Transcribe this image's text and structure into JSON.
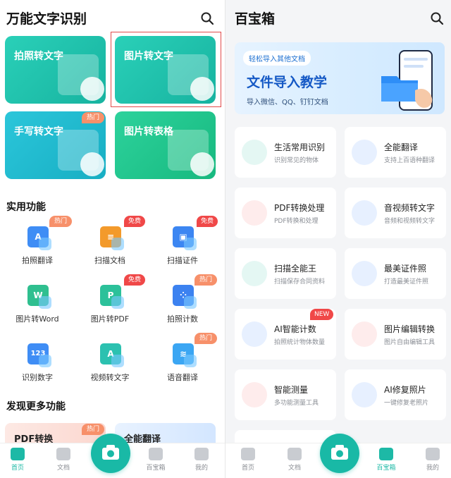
{
  "left": {
    "title": "万能文字识别",
    "cards": [
      {
        "label": "拍照转文字",
        "color": "#1fc2ad"
      },
      {
        "label": "图片转文字",
        "color": "#1fc2ad",
        "selected": true
      },
      {
        "label": "手写转文字",
        "color": "#1fb7c9",
        "badge": "热门"
      },
      {
        "label": "图片转表格",
        "color": "#20c38a"
      }
    ],
    "section_tools": "实用功能",
    "tools": [
      {
        "label": "拍照翻译",
        "icon": "translate-icon",
        "glyph": "A",
        "color": "#3f8df5",
        "badge": "热门"
      },
      {
        "label": "扫描文档",
        "icon": "document-icon",
        "glyph": "≡",
        "color": "#f39a2b",
        "badge_free": "免费"
      },
      {
        "label": "扫描证件",
        "icon": "id-card-icon",
        "glyph": "▣",
        "color": "#3c86f2",
        "badge_free": "免费"
      },
      {
        "label": "图片转Word",
        "icon": "word-icon",
        "glyph": "W",
        "color": "#2fbf8f"
      },
      {
        "label": "图片转PDF",
        "icon": "pdf-icon",
        "glyph": "P",
        "color": "#2cc19a",
        "badge_free": "免费"
      },
      {
        "label": "拍照计数",
        "icon": "count-icon",
        "glyph": "⁘",
        "color": "#3c82f0",
        "badge": "热门"
      },
      {
        "label": "识别数字",
        "icon": "number-icon",
        "glyph": "123",
        "color": "#3f8df5"
      },
      {
        "label": "视频转文字",
        "icon": "video-icon",
        "glyph": "A",
        "color": "#2cc1b0"
      },
      {
        "label": "语音翻译",
        "icon": "voice-icon",
        "glyph": "≋",
        "color": "#3ba6f3",
        "badge": "热门"
      }
    ],
    "section_more": "发现更多功能",
    "promo": [
      {
        "label": "PDF转换",
        "badge": "热门"
      },
      {
        "label": "全能翻译"
      }
    ],
    "tabs": [
      {
        "label": "首页",
        "icon": "home-icon",
        "active": true
      },
      {
        "label": "文档",
        "icon": "document-tab-icon"
      },
      {
        "label": "百宝箱",
        "icon": "toolbox-icon"
      },
      {
        "label": "我的",
        "icon": "profile-icon"
      }
    ]
  },
  "right": {
    "title": "百宝箱",
    "banner": {
      "pill": "轻松导入其他文档",
      "headline": "文件导入教学",
      "sub": "导入微信、QQ、钉钉文档"
    },
    "features": [
      {
        "title": "生活常用识别",
        "sub": "识别常见的物体",
        "icon": "scan-object-icon",
        "color": "#2cc1a0"
      },
      {
        "title": "全能翻译",
        "sub": "支持上百语种翻译",
        "icon": "translate-icon",
        "color": "#3f8df5"
      },
      {
        "title": "PDF转换处理",
        "sub": "PDF转换和处理",
        "icon": "pdf-icon",
        "color": "#ef5a5a"
      },
      {
        "title": "音视频转文字",
        "sub": "音频和视频转文字",
        "icon": "video-icon",
        "color": "#3f8df5"
      },
      {
        "title": "扫描全能王",
        "sub": "扫描保存合同资料",
        "icon": "scan-icon",
        "color": "#2cc1a0"
      },
      {
        "title": "最美证件照",
        "sub": "打造最美证件照",
        "icon": "portrait-icon",
        "color": "#3f8df5"
      },
      {
        "title": "AI智能计数",
        "sub": "拍照统计物体数量",
        "icon": "count-icon",
        "color": "#3f8df5",
        "badge": "NEW"
      },
      {
        "title": "图片编辑转换",
        "sub": "图片自由编辑工具",
        "icon": "image-edit-icon",
        "color": "#ef5a5a"
      },
      {
        "title": "智能测量",
        "sub": "多功能测量工具",
        "icon": "ruler-icon",
        "color": "#ef5a5a"
      },
      {
        "title": "AI修复照片",
        "sub": "一键修复老照片",
        "icon": "photo-restore-icon",
        "color": "#3f8df5"
      }
    ],
    "tabs": [
      {
        "label": "首页",
        "icon": "home-icon"
      },
      {
        "label": "文档",
        "icon": "document-tab-icon"
      },
      {
        "label": "百宝箱",
        "icon": "toolbox-icon",
        "active": true
      },
      {
        "label": "我的",
        "icon": "profile-icon"
      }
    ]
  },
  "colors": {
    "accent": "#19b9a6",
    "highlight_border": "#e24a4a",
    "banner_text": "#1559c5"
  }
}
